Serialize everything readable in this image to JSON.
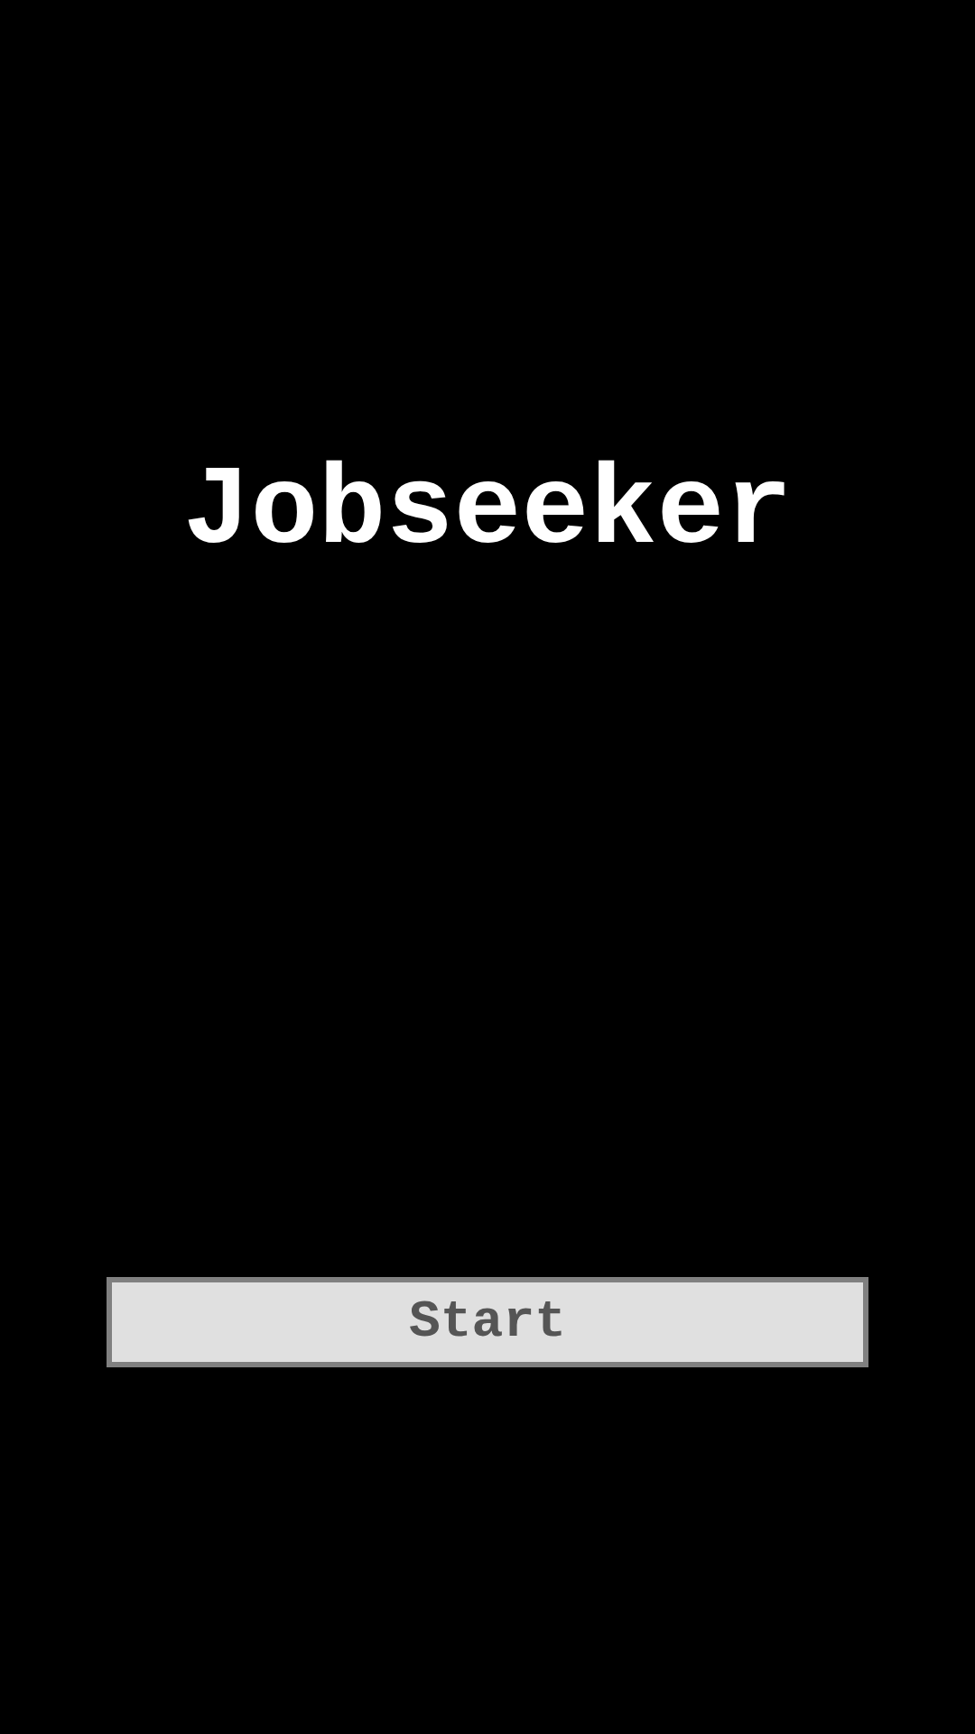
{
  "title": "Jobseeker",
  "buttons": [
    {
      "label": "Start"
    }
  ]
}
